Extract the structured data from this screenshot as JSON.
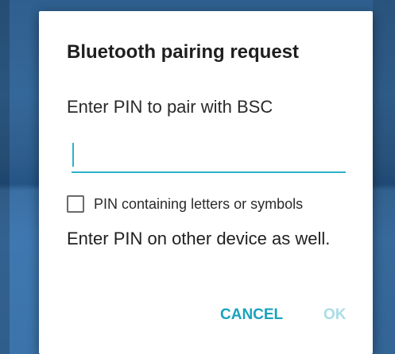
{
  "dialog": {
    "title": "Bluetooth pairing request",
    "message": "Enter PIN to pair with BSC",
    "pin_input": {
      "value": "",
      "placeholder": ""
    },
    "checkbox": {
      "label": "PIN containing letters or symbols",
      "checked": false
    },
    "info": "Enter PIN on other device as well.",
    "buttons": {
      "cancel": "CANCEL",
      "ok": "OK"
    }
  },
  "colors": {
    "accent": "#1aa3bd",
    "ok_disabled": "#a9dde6"
  }
}
